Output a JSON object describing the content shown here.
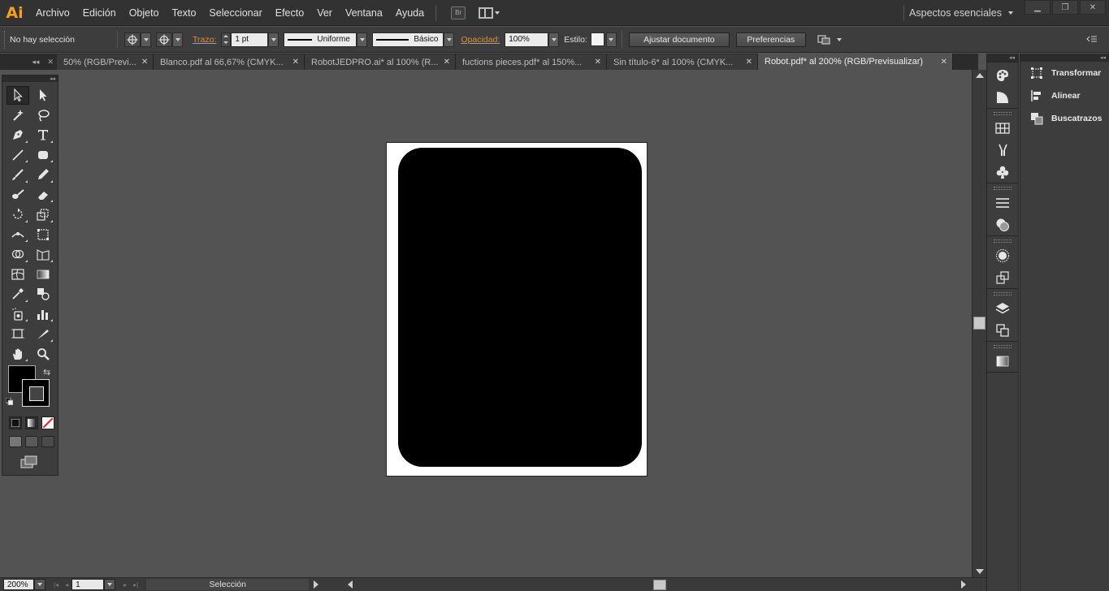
{
  "app": {
    "logo": "Ai",
    "menu": [
      "Archivo",
      "Edición",
      "Objeto",
      "Texto",
      "Seleccionar",
      "Efecto",
      "Ver",
      "Ventana",
      "Ayuda"
    ],
    "bridge_label": "Br",
    "workspace": "Aspectos esenciales",
    "window_controls": [
      "▁",
      "❐",
      "✕"
    ]
  },
  "control_bar": {
    "selection_status": "No hay selección",
    "stroke_label": "Trazo:",
    "stroke_weight": "1 pt",
    "stroke_profile": "Uniforme",
    "brush": "Básico",
    "opacity_label": "Opacidad:",
    "opacity_value": "100%",
    "style_label": "Estilo:",
    "document_setup_button": "Ajustar documento",
    "preferences_button": "Preferencias"
  },
  "tabs": [
    {
      "label": "50% (RGB/Previ...",
      "active": false
    },
    {
      "label": "Blanco.pdf al 66,67% (CMYK...",
      "active": false
    },
    {
      "label": "RobotJEDPRO.ai* al 100% (R...",
      "active": false
    },
    {
      "label": "fuctions pieces.pdf* al 150%...",
      "active": false
    },
    {
      "label": "Sin título-6* al 100% (CMYK...",
      "active": false
    },
    {
      "label": "Robot.pdf* al 200% (RGB/Previsualizar)",
      "active": true
    }
  ],
  "tab_close": "✕",
  "status_bar": {
    "zoom": "200%",
    "page": "1",
    "tool_status": "Selección"
  },
  "right_panel": {
    "items": [
      "Transformar",
      "Alinear",
      "Buscatrazos"
    ]
  },
  "colors": {
    "accent": "#f7a01c",
    "fill": "#000000",
    "artboard": "#ffffff"
  }
}
